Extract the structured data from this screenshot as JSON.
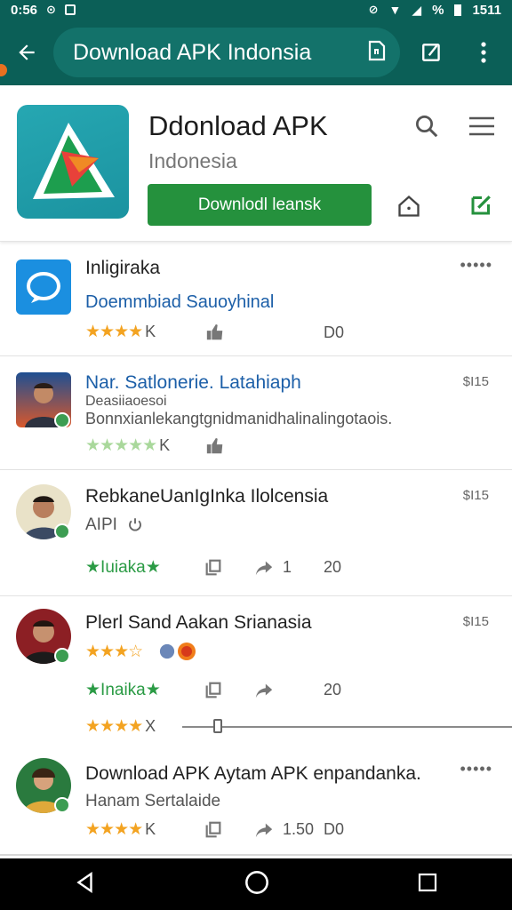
{
  "status": {
    "time": "0:56",
    "battery": "%",
    "clock": "1511"
  },
  "appbar": {
    "url": "Download APK Indonsia"
  },
  "header": {
    "title": "Ddonload APK",
    "subtitle": "Indonesia",
    "download_label": "Downlodl leansk"
  },
  "items": [
    {
      "title": "Inligiraka",
      "subtitle": "Doemmbiad Sauoyhinal",
      "rating_suffix": "K",
      "count": "D0"
    },
    {
      "title": "Nar. Satlonerie. Latahiaph",
      "line2": "Deasiiaoesoi",
      "line3": "Bonnxianlekangtgnidmanidhalinalingotaois.",
      "rating_suffix": "K",
      "price": "$I15"
    },
    {
      "title": "RebkaneUanIgInka Ilolcensia",
      "subtitle": "AIPI",
      "rating_label": "Iuiaka",
      "share_count": "1",
      "count": "20",
      "price": "$I15"
    },
    {
      "title": "Plerl Sand Aakan Srianasia",
      "rating_label": "Inaika",
      "count": "20",
      "rating_suffix": "X",
      "price": "$I15"
    },
    {
      "title": "Download APK Aytam APK enpandanka.",
      "subtitle": "Hanam Sertalaide",
      "rating_suffix": "K",
      "share_count": "1.50",
      "count": "D0"
    }
  ],
  "colors": {
    "appbar": "#0b5f57",
    "accent": "#25913d",
    "star": "#f3a321",
    "link": "#1c5fa8"
  }
}
